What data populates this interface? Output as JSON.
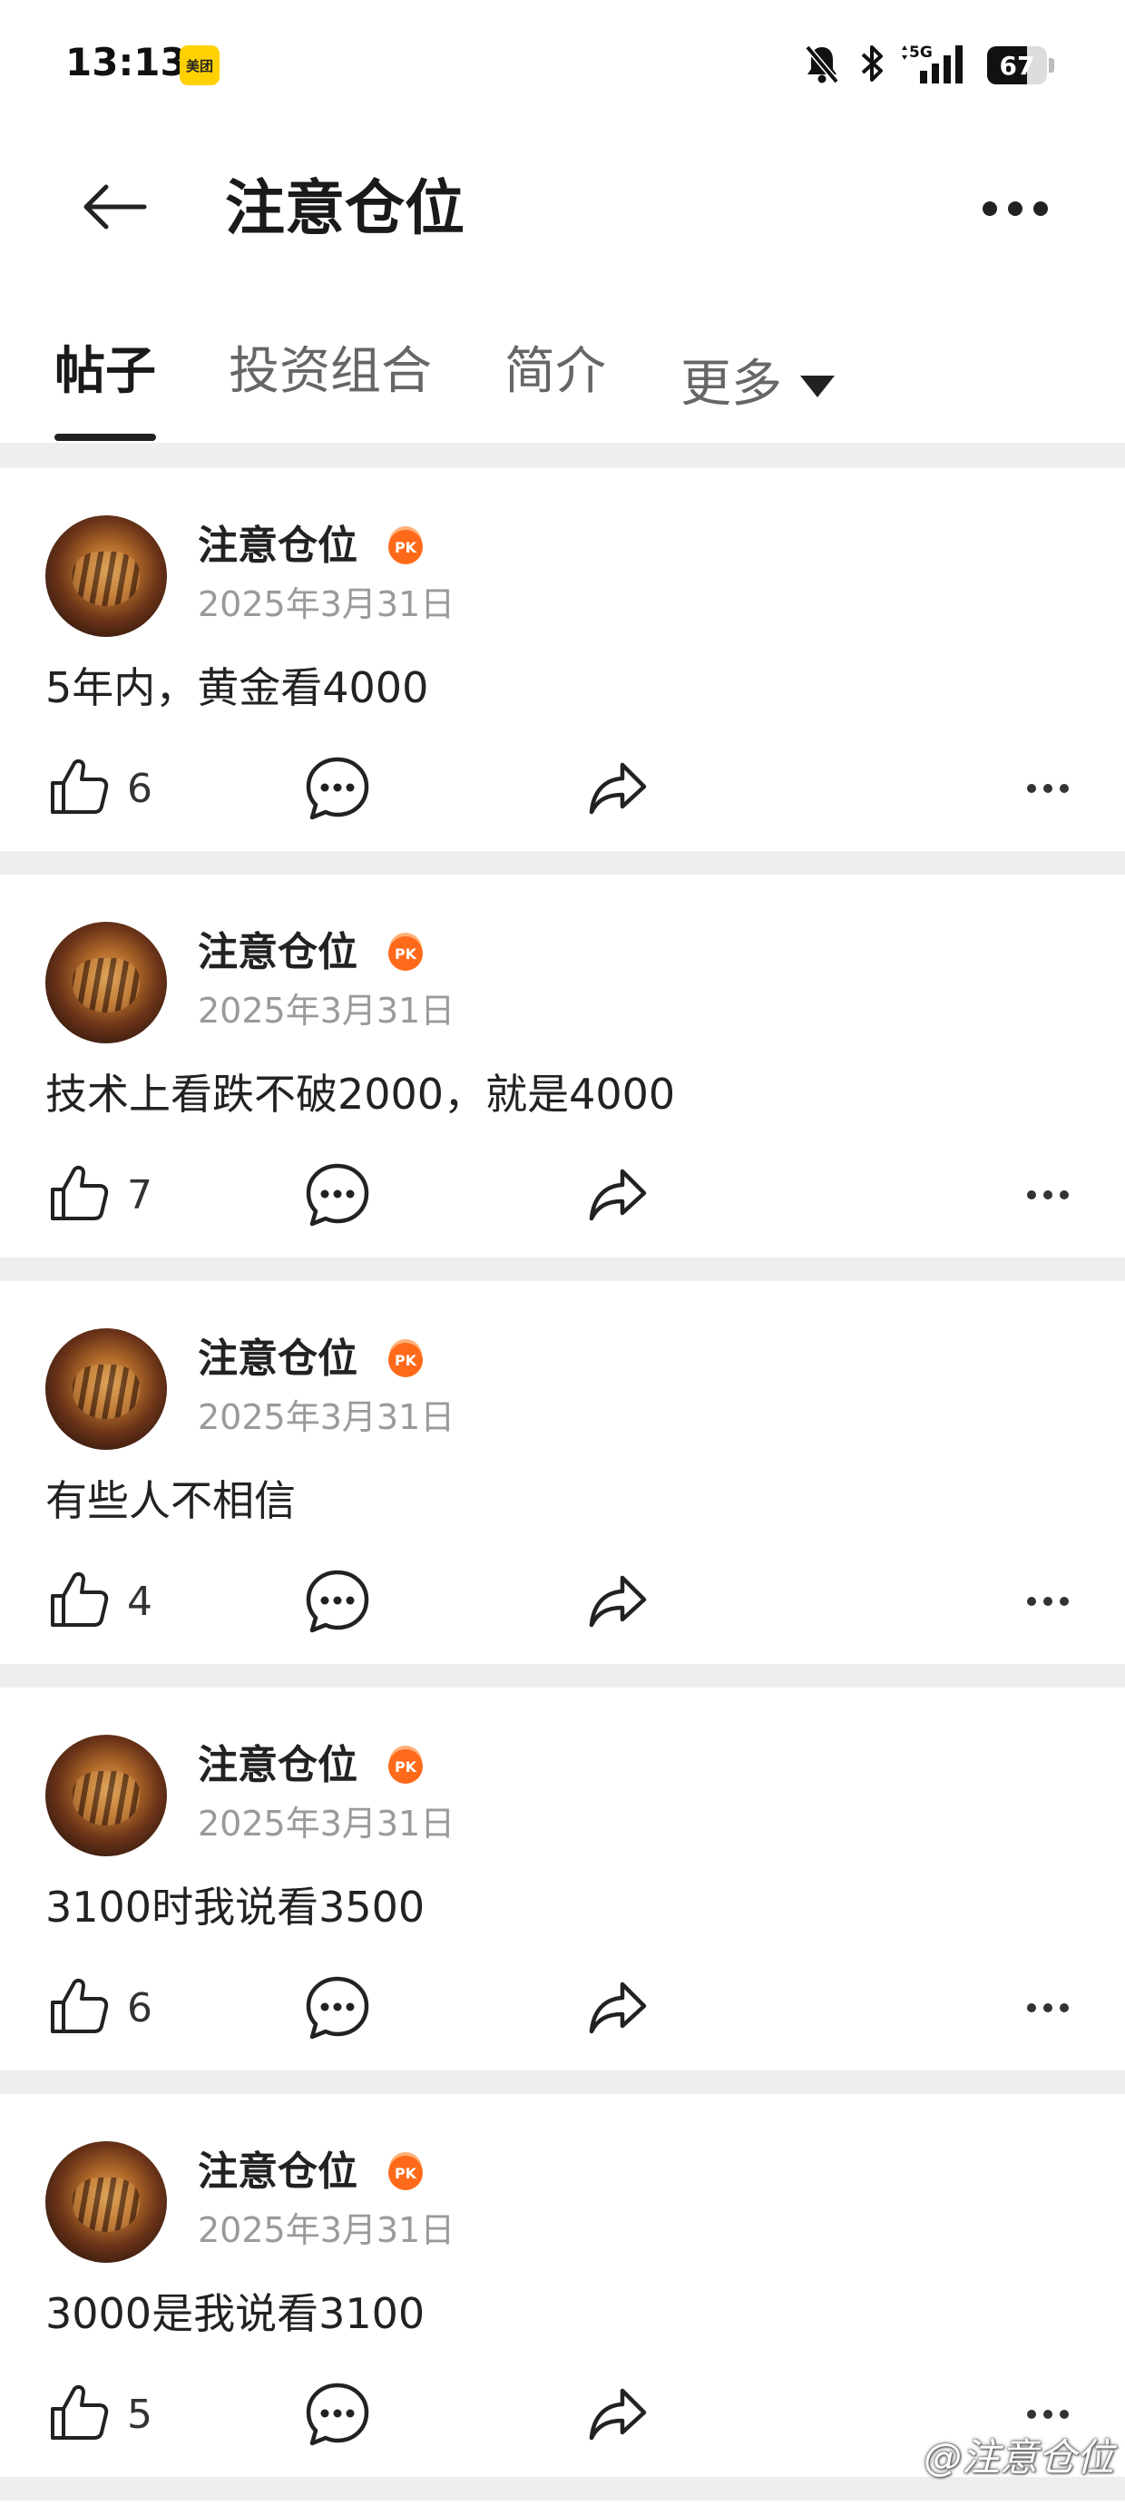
{
  "status_bar": {
    "time": "13:13",
    "app_badge": "美团",
    "battery": "67",
    "battery_level": 0.67,
    "network": "5G"
  },
  "header": {
    "title": "注意仓位"
  },
  "tabs": [
    {
      "label": "帖子",
      "active": true
    },
    {
      "label": "投资组合",
      "active": false
    },
    {
      "label": "简介",
      "active": false
    },
    {
      "label": "更多",
      "active": false
    }
  ],
  "posts": [
    {
      "author": "注意仓位",
      "badge": "PK",
      "date": "2025年3月31日",
      "text": "5年内，黄金看4000",
      "likes": "6"
    },
    {
      "author": "注意仓位",
      "badge": "PK",
      "date": "2025年3月31日",
      "text": "技术上看跌不破2000，就是4000",
      "likes": "7"
    },
    {
      "author": "注意仓位",
      "badge": "PK",
      "date": "2025年3月31日",
      "text": "有些人不相信",
      "likes": "4"
    },
    {
      "author": "注意仓位",
      "badge": "PK",
      "date": "2025年3月31日",
      "text": "3100时我说看3500",
      "likes": "6"
    },
    {
      "author": "注意仓位",
      "badge": "PK",
      "date": "2025年3月31日",
      "text": "3000是我说看3100",
      "likes": "5"
    }
  ],
  "watermark": "@注意仓位",
  "colors": {
    "badge_orange": "#ff6a1a",
    "meituan_yellow": "#ffd100",
    "separator": "#eeeeee"
  }
}
